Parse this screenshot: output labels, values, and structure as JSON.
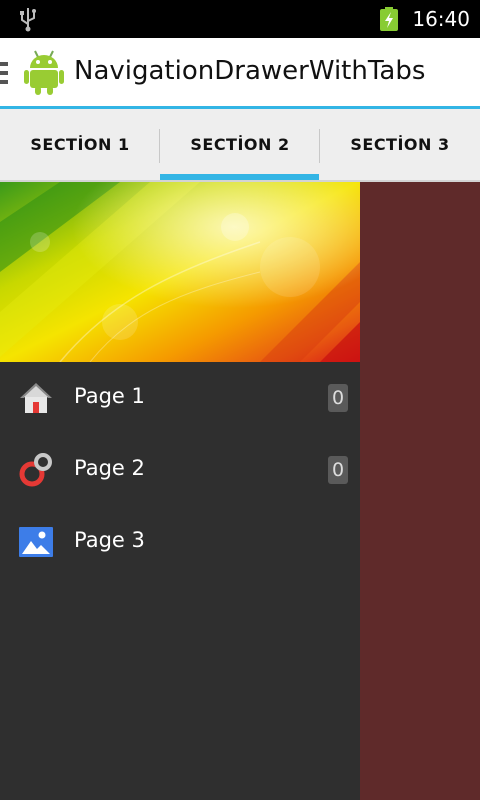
{
  "status_bar": {
    "time": "16:40",
    "icons": [
      "usb-icon",
      "battery-charging-icon"
    ]
  },
  "action_bar": {
    "title": "NavigationDrawerWithTabs",
    "icon": "android-icon"
  },
  "tabs": [
    {
      "label": "SECTİON 1",
      "selected": false
    },
    {
      "label": "SECTİON 2",
      "selected": true
    },
    {
      "label": "SECTİON 3",
      "selected": false
    }
  ],
  "drawer": {
    "items": [
      {
        "label": "Page 1",
        "icon": "home-icon",
        "counter": "0"
      },
      {
        "label": "Page 2",
        "icon": "ring-icon",
        "counter": "0"
      },
      {
        "label": "Page 3",
        "icon": "image-icon",
        "counter": ""
      }
    ]
  },
  "colors": {
    "accent": "#33b5e5",
    "drawer_bg": "#2f2f2f",
    "content_bg": "#5f2a2a"
  }
}
